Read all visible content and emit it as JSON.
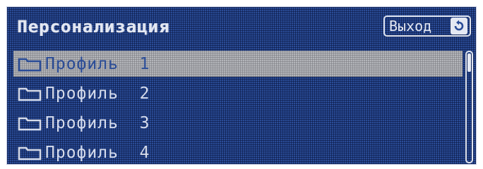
{
  "header": {
    "title": "Персонализация",
    "exit_label": "Выход"
  },
  "profiles": {
    "items": [
      {
        "label": "Профиль  1",
        "selected": true
      },
      {
        "label": "Профиль  2",
        "selected": false
      },
      {
        "label": "Профиль  3",
        "selected": false
      },
      {
        "label": "Профиль  4",
        "selected": false
      }
    ],
    "row_icon": "folder-icon"
  },
  "scrollbar": {
    "position": 0
  },
  "colors": {
    "screen_bg": "#2a4c97",
    "text": "#e4e8f2",
    "selected_row": "#b4b6bb"
  },
  "icons": {
    "exit": "return-arrow-icon",
    "row": "folder-icon"
  }
}
